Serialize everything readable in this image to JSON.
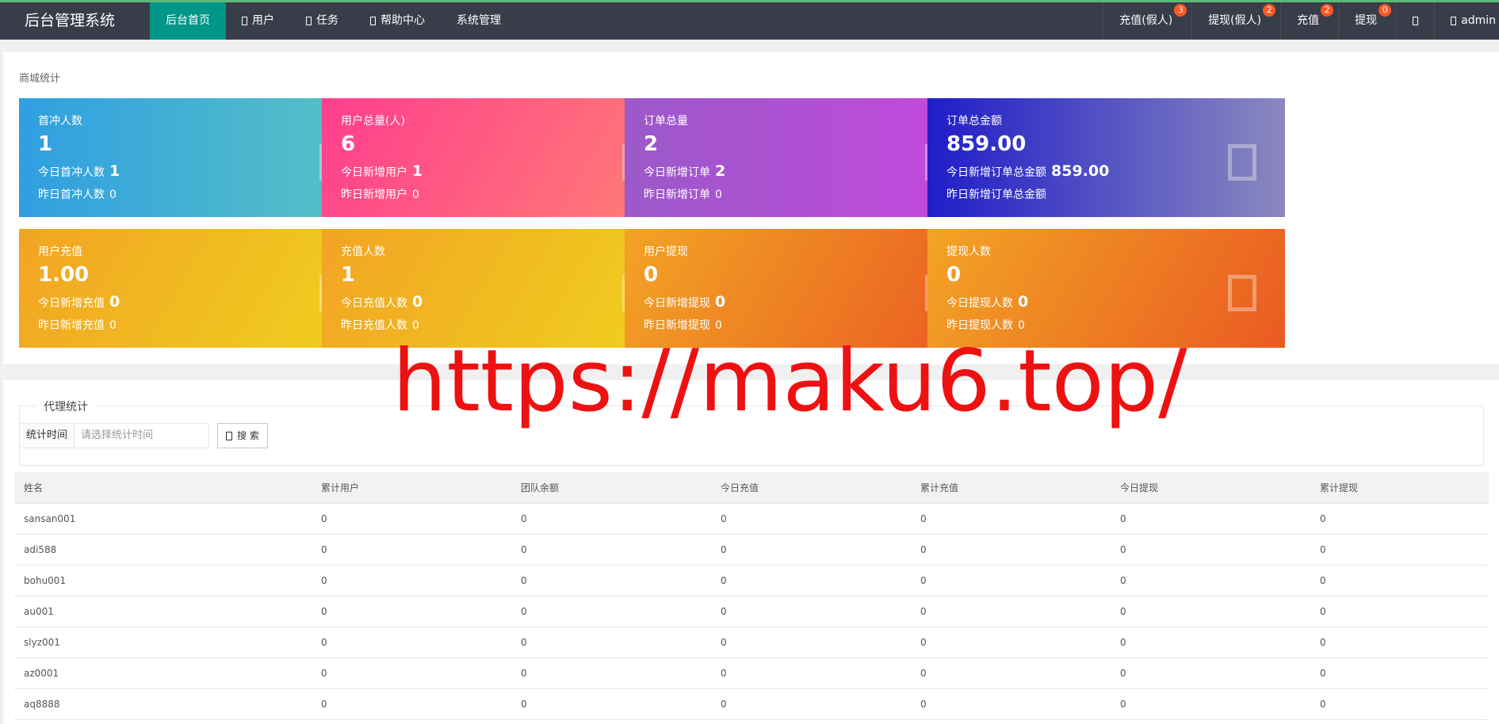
{
  "header": {
    "logo": "后台管理系统",
    "nav": [
      {
        "label": "后台首页",
        "icon": ""
      },
      {
        "label": "用户",
        "icon": "user-icon"
      },
      {
        "label": "任务",
        "icon": "task-icon"
      },
      {
        "label": "帮助中心",
        "icon": "help-icon"
      },
      {
        "label": "系统管理",
        "icon": ""
      }
    ],
    "right": [
      {
        "label": "充值(假人)",
        "badge": "3"
      },
      {
        "label": "提现(假人)",
        "badge": "2"
      },
      {
        "label": "充值",
        "badge": "2"
      },
      {
        "label": "提现",
        "badge": "0"
      },
      {
        "label": "",
        "icon": "notification-icon"
      },
      {
        "label": "admin",
        "icon": "user-icon"
      }
    ]
  },
  "stats": {
    "title": "商城统计",
    "cards": [
      {
        "title": "首冲人数",
        "value": "1",
        "sub1_label": "今日首冲人数",
        "sub1_value": "1",
        "sub2_label": "昨日首冲人数",
        "sub2_value": "0"
      },
      {
        "title": "用户总量(人)",
        "value": "6",
        "sub1_label": "今日新增用户",
        "sub1_value": "1",
        "sub2_label": "昨日新增用户",
        "sub2_value": "0"
      },
      {
        "title": "订单总量",
        "value": "2",
        "sub1_label": "今日新增订单",
        "sub1_value": "2",
        "sub2_label": "昨日新增订单",
        "sub2_value": "0"
      },
      {
        "title": "订单总金额",
        "value": "859.00",
        "sub1_label": "今日新增订单总金额",
        "sub1_value": "859.00",
        "sub2_label": "昨日新增订单总金额",
        "sub2_value": ""
      },
      {
        "title": "用户充值",
        "value": "1.00",
        "sub1_label": "今日新增充值",
        "sub1_value": "0",
        "sub2_label": "昨日新增充值",
        "sub2_value": "0"
      },
      {
        "title": "充值人数",
        "value": "1",
        "sub1_label": "今日充值人数",
        "sub1_value": "0",
        "sub2_label": "昨日充值人数",
        "sub2_value": "0"
      },
      {
        "title": "用户提现",
        "value": "0",
        "sub1_label": "今日新增提现",
        "sub1_value": "0",
        "sub2_label": "昨日新增提现",
        "sub2_value": "0"
      },
      {
        "title": "提现人数",
        "value": "0",
        "sub1_label": "今日提现人数",
        "sub1_value": "0",
        "sub2_label": "昨日提现人数",
        "sub2_value": "0"
      }
    ]
  },
  "agent": {
    "legend": "代理统计",
    "time_label": "统计时间",
    "time_placeholder": "请选择统计时间",
    "search_label": "搜 索",
    "columns": [
      "姓名",
      "累计用户",
      "团队余额",
      "今日充值",
      "累计充值",
      "今日提现",
      "累计提现"
    ],
    "rows": [
      [
        "sansan001",
        "0",
        "0",
        "0",
        "0",
        "0",
        "0"
      ],
      [
        "adi588",
        "0",
        "0",
        "0",
        "0",
        "0",
        "0"
      ],
      [
        "bohu001",
        "0",
        "0",
        "0",
        "0",
        "0",
        "0"
      ],
      [
        "au001",
        "0",
        "0",
        "0",
        "0",
        "0",
        "0"
      ],
      [
        "slyz001",
        "0",
        "0",
        "0",
        "0",
        "0",
        "0"
      ],
      [
        "az0001",
        "0",
        "0",
        "0",
        "0",
        "0",
        "0"
      ],
      [
        "aq8888",
        "0",
        "0",
        "0",
        "0",
        "0",
        "0"
      ]
    ]
  },
  "watermark": "https://maku6.top/"
}
